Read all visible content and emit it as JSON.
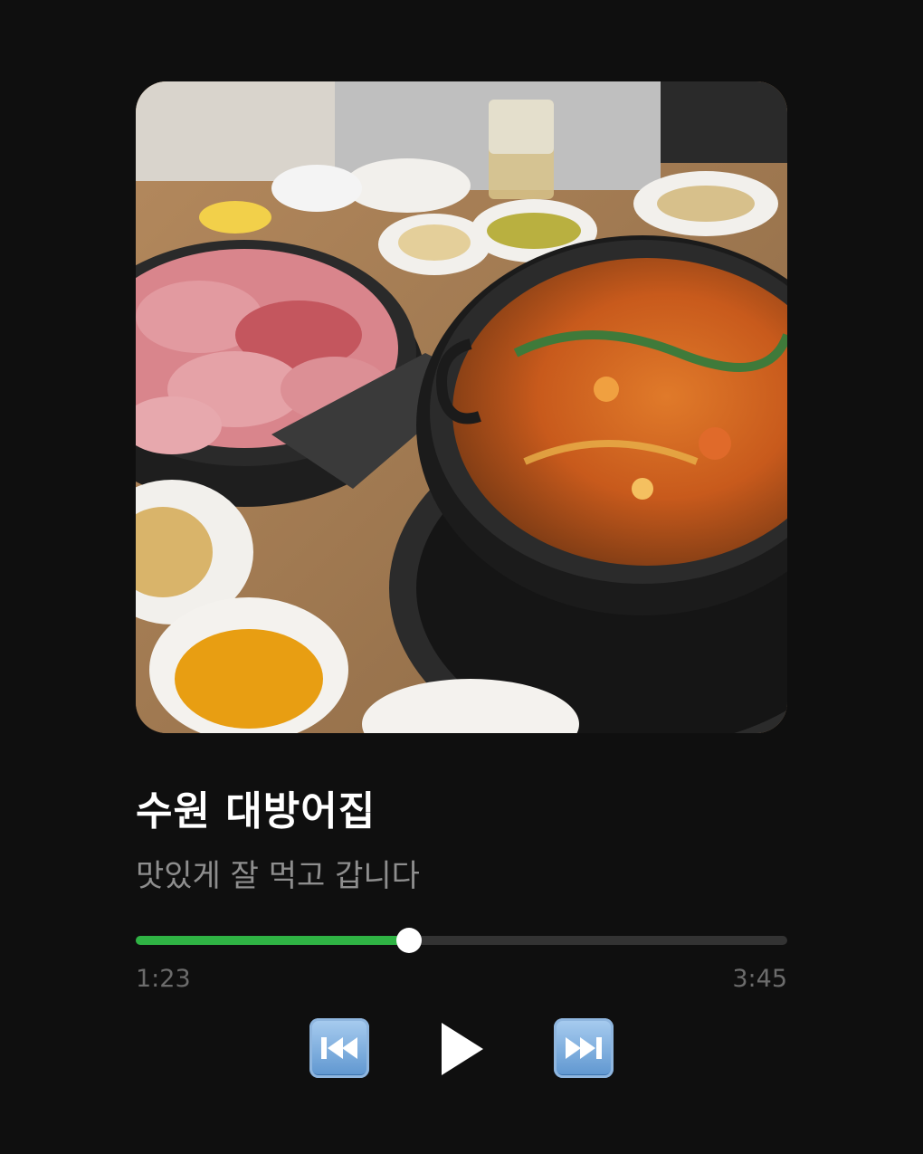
{
  "track": {
    "title": "수원 대방어집",
    "artist": "맛있게 잘 먹고 갑니다",
    "cover_icon": "food-photo"
  },
  "player": {
    "elapsed": "1:23",
    "duration": "3:45",
    "progress_fraction": 0.42,
    "accent_color": "#2fb344"
  },
  "controls": {
    "prev_icon": "rewind-icon",
    "play_icon": "play-icon",
    "next_icon": "fast-forward-icon"
  }
}
